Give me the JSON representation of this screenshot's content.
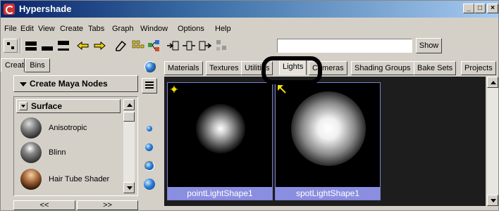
{
  "window": {
    "title": "Hypershade",
    "controls": [
      "_",
      "□",
      "×"
    ]
  },
  "menu": [
    "File",
    "Edit",
    "View",
    "Create",
    "Tabs",
    "Graph",
    "Window",
    "Options",
    "Help"
  ],
  "toolbar": {
    "search_value": "",
    "show_label": "Show"
  },
  "left_panel": {
    "tabs": [
      "Create",
      "Bins"
    ],
    "create_button": "Create Maya Nodes",
    "category": "Surface",
    "items": [
      "Anisotropic",
      "Blinn",
      "Hair Tube Shader"
    ],
    "bottom_arrows": [
      "<<",
      ">>"
    ]
  },
  "tabs": [
    "Materials",
    "Textures",
    "Utilities",
    "Lights",
    "Cameras",
    "Shading Groups",
    "Bake Sets",
    "Projects"
  ],
  "active_tab": "Lights",
  "swatches": [
    {
      "label": "pointLightShape1",
      "icon": "point-light-icon"
    },
    {
      "label": "spotLightShape1",
      "icon": "spot-light-icon"
    }
  ],
  "colors": {
    "title_bar": "#0a246a",
    "swatch_label": "#8a8ee0",
    "panel_bg": "#d4d0c8"
  }
}
